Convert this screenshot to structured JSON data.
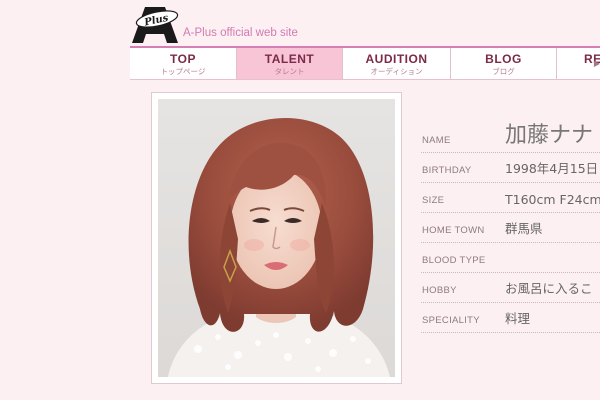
{
  "header": {
    "logo_name": "A Plus",
    "tagline": "A-Plus official web site"
  },
  "nav": {
    "items": [
      {
        "en": "TOP",
        "ja": "トップページ"
      },
      {
        "en": "TALENT",
        "ja": "タレント"
      },
      {
        "en": "AUDITION",
        "ja": "オーディション"
      },
      {
        "en": "BLOG",
        "ja": "ブログ"
      },
      {
        "en": "RE",
        "ja": ""
      }
    ],
    "active_index": 1
  },
  "profile": {
    "name_label": "NAME",
    "name": "加藤ナナ",
    "birthday_label": "BIRTHDAY",
    "birthday": "1998年4月15日",
    "size_label": "SIZE",
    "size": "T160cm F24cm",
    "hometown_label": "HOME TOWN",
    "hometown": "群馬県",
    "blood_label": "BLOOD TYPE",
    "blood": "",
    "hobby_label": "HOBBY",
    "hobby": "お風呂に入るこ",
    "speciality_label": "SPECIALITY",
    "speciality": "料理"
  },
  "colors": {
    "background": "#fdf0f2",
    "accent": "#d77fb4",
    "nav_active": "#f7c5d6",
    "nav_text": "#7b2a48"
  }
}
